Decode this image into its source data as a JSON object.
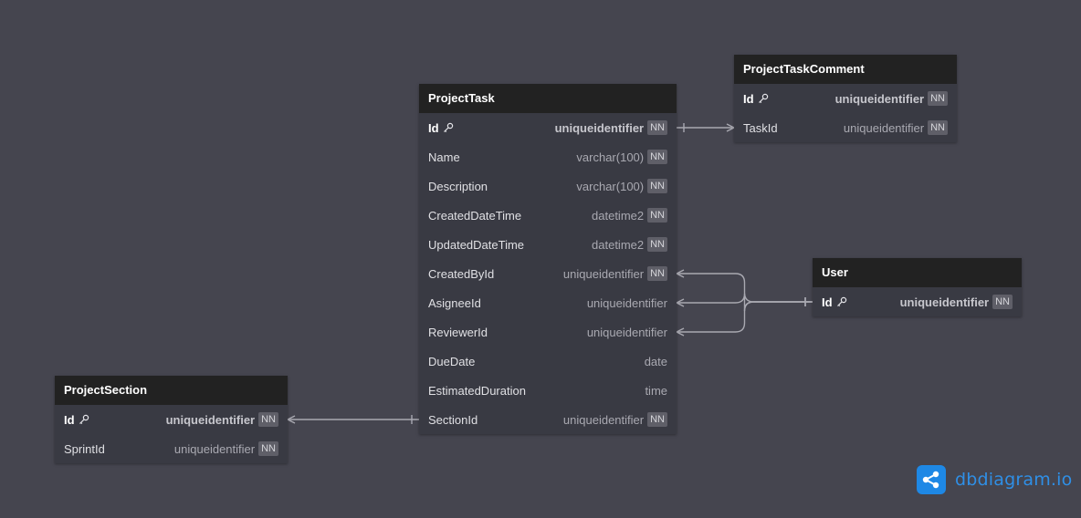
{
  "tables": [
    {
      "name": "ProjectTask",
      "fields": [
        {
          "name": "Id",
          "type": "uniqueidentifier",
          "nn": "NN",
          "pk": true
        },
        {
          "name": "Name",
          "type": "varchar(100)",
          "nn": "NN"
        },
        {
          "name": "Description",
          "type": "varchar(100)",
          "nn": "NN"
        },
        {
          "name": "CreatedDateTime",
          "type": "datetime2",
          "nn": "NN"
        },
        {
          "name": "UpdatedDateTime",
          "type": "datetime2",
          "nn": "NN"
        },
        {
          "name": "CreatedById",
          "type": "uniqueidentifier",
          "nn": "NN"
        },
        {
          "name": "AsigneeId",
          "type": "uniqueidentifier"
        },
        {
          "name": "ReviewerId",
          "type": "uniqueidentifier"
        },
        {
          "name": "DueDate",
          "type": "date"
        },
        {
          "name": "EstimatedDuration",
          "type": "time"
        },
        {
          "name": "SectionId",
          "type": "uniqueidentifier",
          "nn": "NN"
        }
      ]
    },
    {
      "name": "ProjectTaskComment",
      "fields": [
        {
          "name": "Id",
          "type": "uniqueidentifier",
          "nn": "NN",
          "pk": true
        },
        {
          "name": "TaskId",
          "type": "uniqueidentifier",
          "nn": "NN"
        }
      ]
    },
    {
      "name": "User",
      "fields": [
        {
          "name": "Id",
          "type": "uniqueidentifier",
          "nn": "NN",
          "pk": true
        }
      ]
    },
    {
      "name": "ProjectSection",
      "fields": [
        {
          "name": "Id",
          "type": "uniqueidentifier",
          "nn": "NN",
          "pk": true
        },
        {
          "name": "SprintId",
          "type": "uniqueidentifier",
          "nn": "NN"
        }
      ]
    }
  ],
  "relations": [
    {
      "from": "ProjectTaskComment.TaskId",
      "to": "ProjectTask.Id",
      "type": "many-to-one"
    },
    {
      "from": "ProjectTask.CreatedById",
      "to": "User.Id",
      "type": "many-to-one"
    },
    {
      "from": "ProjectTask.AsigneeId",
      "to": "User.Id",
      "type": "many-to-one"
    },
    {
      "from": "ProjectTask.ReviewerId",
      "to": "User.Id",
      "type": "many-to-one"
    },
    {
      "from": "ProjectSection.Id",
      "to": "ProjectTask.SectionId",
      "type": "many-to-one"
    }
  ],
  "branding": {
    "logo_text": "dbdiagram.io",
    "logo_color": "#1e88e5"
  },
  "colors": {
    "canvas": "#45454f",
    "header": "#222222",
    "body": "#393a43",
    "edge": "#a9a9b1"
  }
}
